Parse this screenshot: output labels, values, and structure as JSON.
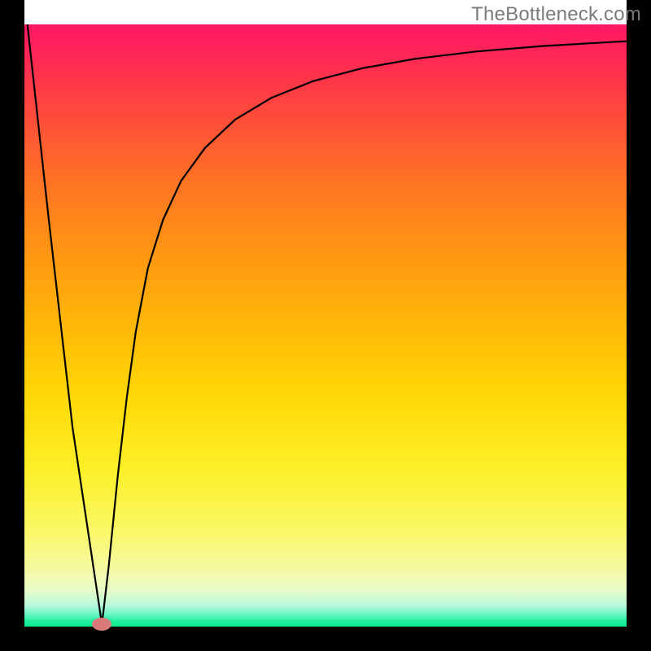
{
  "watermark": "TheBottleneck.com",
  "chart_data": {
    "type": "line",
    "title": "",
    "xlabel": "",
    "ylabel": "",
    "xlim": [
      0,
      1
    ],
    "ylim": [
      0,
      1
    ],
    "series": [
      {
        "name": "curve",
        "x": [
          0.005,
          0.04,
          0.08,
          0.1287,
          0.14,
          0.155,
          0.17,
          0.185,
          0.205,
          0.23,
          0.26,
          0.3,
          0.35,
          0.41,
          0.48,
          0.56,
          0.65,
          0.75,
          0.86,
          0.98,
          1.0
        ],
        "y": [
          0.0,
          0.32,
          0.67,
          0.996,
          0.9,
          0.75,
          0.62,
          0.51,
          0.405,
          0.325,
          0.26,
          0.205,
          0.158,
          0.122,
          0.094,
          0.073,
          0.057,
          0.045,
          0.036,
          0.029,
          0.028
        ]
      }
    ],
    "marker": {
      "x": 0.1287,
      "y": 0.996
    },
    "background_gradient": {
      "top": "#ff1863",
      "bottom": "#0cec8e"
    }
  }
}
